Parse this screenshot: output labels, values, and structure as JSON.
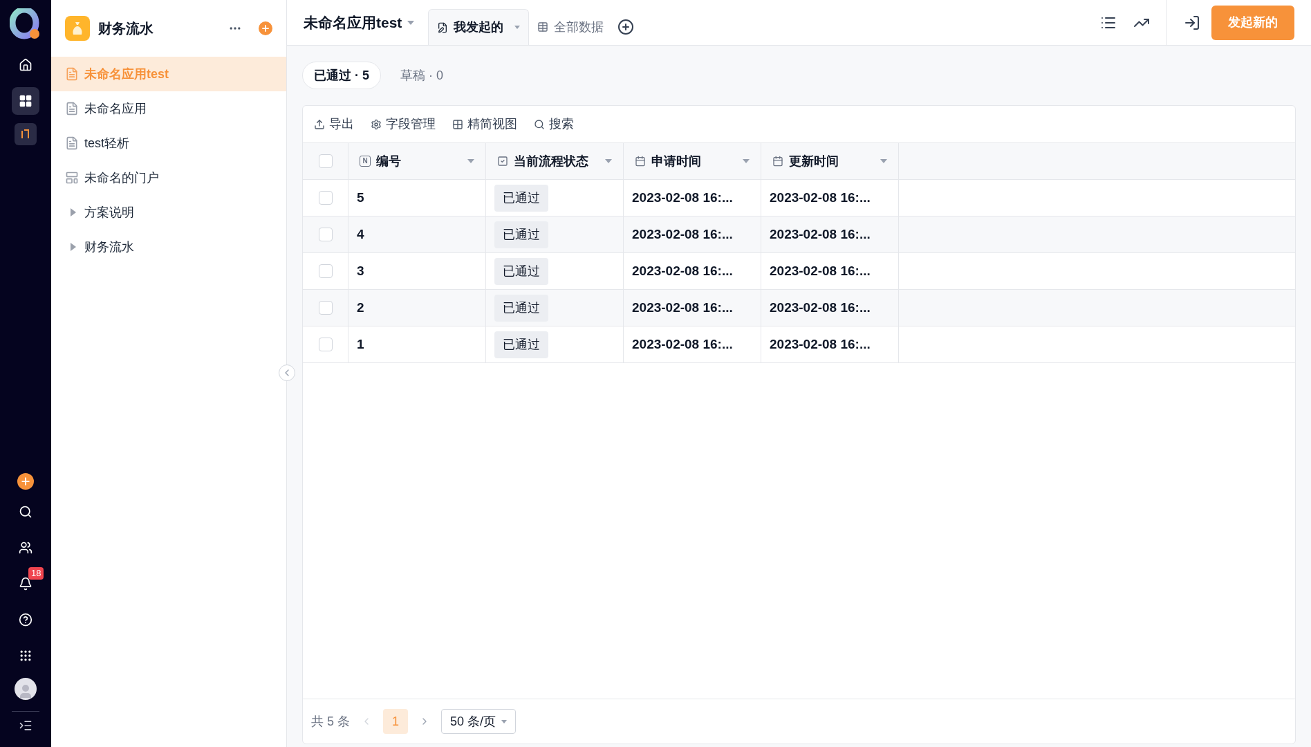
{
  "rail": {
    "items": [
      {
        "kind": "home",
        "selected": false
      },
      {
        "kind": "apps",
        "selected": true
      },
      {
        "kind": "portal",
        "selected": false
      }
    ],
    "bottom": [
      {
        "kind": "add"
      },
      {
        "kind": "search"
      },
      {
        "kind": "users"
      },
      {
        "kind": "bell",
        "badge": "18"
      },
      {
        "kind": "help"
      },
      {
        "kind": "grid"
      },
      {
        "kind": "avatar"
      },
      {
        "kind": "expand"
      }
    ]
  },
  "sidebar": {
    "title": "财务流水",
    "items": [
      {
        "kind": "form",
        "label": "未命名应用test",
        "selected": true
      },
      {
        "kind": "form",
        "label": "未命名应用",
        "selected": false
      },
      {
        "kind": "form",
        "label": "test轻析",
        "selected": false
      },
      {
        "kind": "portal",
        "label": "未命名的门户",
        "selected": false
      },
      {
        "kind": "folder",
        "label": "方案说明",
        "selected": false,
        "expanded": false
      },
      {
        "kind": "folder",
        "label": "财务流水",
        "selected": false,
        "expanded": false
      }
    ]
  },
  "header": {
    "app_title": "未命名应用test",
    "tabs": [
      {
        "kind": "mine",
        "label": "我发起的",
        "selected": true
      },
      {
        "kind": "all",
        "label": "全部数据",
        "selected": false
      }
    ],
    "primary_button": "发起新的"
  },
  "filters": [
    {
      "label": "已通过 · 5",
      "selected": true
    },
    {
      "label": "草稿 · 0",
      "selected": false
    }
  ],
  "toolbar": [
    {
      "kind": "export",
      "label": "导出"
    },
    {
      "kind": "fields",
      "label": "字段管理"
    },
    {
      "kind": "compact",
      "label": "精简视图"
    },
    {
      "kind": "search",
      "label": "搜索"
    }
  ],
  "table": {
    "select_all": {
      "checked": false
    },
    "columns": [
      {
        "kind": "number",
        "label": "编号",
        "icon_text": "N"
      },
      {
        "kind": "check",
        "label": "当前流程状态"
      },
      {
        "kind": "date",
        "label": "申请时间"
      },
      {
        "kind": "date",
        "label": "更新时间"
      }
    ],
    "rows": [
      {
        "checked": false,
        "cells": [
          "5",
          "已通过",
          "2023-02-08 16:...",
          "2023-02-08 16:..."
        ]
      },
      {
        "checked": false,
        "cells": [
          "4",
          "已通过",
          "2023-02-08 16:...",
          "2023-02-08 16:..."
        ]
      },
      {
        "checked": false,
        "cells": [
          "3",
          "已通过",
          "2023-02-08 16:...",
          "2023-02-08 16:..."
        ]
      },
      {
        "checked": false,
        "cells": [
          "2",
          "已通过",
          "2023-02-08 16:...",
          "2023-02-08 16:..."
        ]
      },
      {
        "checked": false,
        "cells": [
          "1",
          "已通过",
          "2023-02-08 16:...",
          "2023-02-08 16:..."
        ]
      }
    ]
  },
  "pagination": {
    "total": "共 5 条",
    "pages": [
      {
        "label": "1",
        "selected": true
      }
    ],
    "page_size": "50 条/页"
  }
}
